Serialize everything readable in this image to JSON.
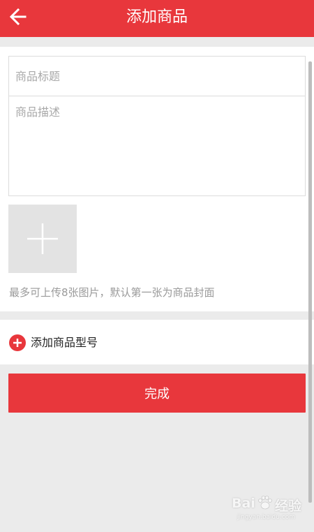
{
  "header": {
    "title": "添加商品",
    "back_icon": "arrow-left-icon",
    "color": "#e8373c"
  },
  "form": {
    "title_placeholder": "商品标题",
    "title_value": "",
    "description_placeholder": "商品描述",
    "description_value": "",
    "add_image_icon": "plus-icon",
    "upload_hint": "最多可上传8张图片，默认第一张为商品封面"
  },
  "model": {
    "label": "添加商品型号",
    "icon": "plus-circle-icon"
  },
  "actions": {
    "done_label": "完成"
  },
  "watermark": {
    "text": "Bai",
    "text2": "经验",
    "sub": "jingyan.baidu.com"
  }
}
